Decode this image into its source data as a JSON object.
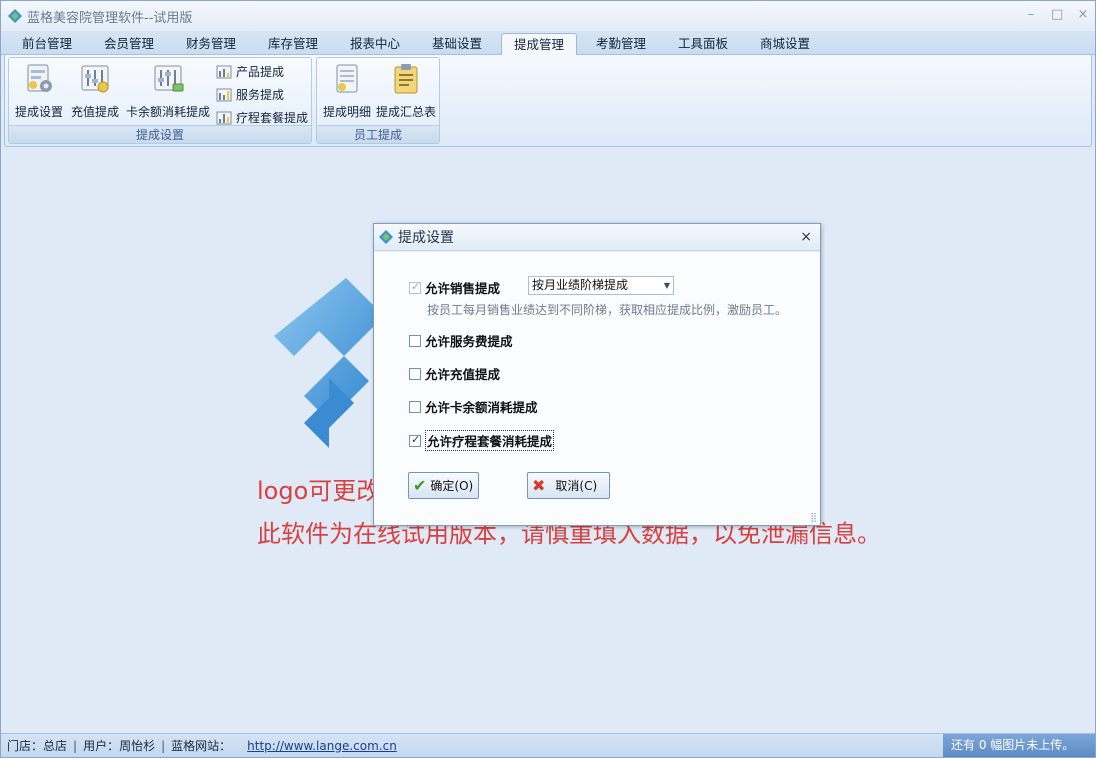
{
  "window": {
    "title": "蓝格美容院管理软件--试用版",
    "controls": {
      "minimize": "–",
      "maximize": "□",
      "close": "×"
    }
  },
  "tabs": [
    {
      "label": "前台管理",
      "active": false
    },
    {
      "label": "会员管理",
      "active": false
    },
    {
      "label": "财务管理",
      "active": false
    },
    {
      "label": "库存管理",
      "active": false
    },
    {
      "label": "报表中心",
      "active": false
    },
    {
      "label": "基础设置",
      "active": false
    },
    {
      "label": "提成管理",
      "active": true
    },
    {
      "label": "考勤管理",
      "active": false
    },
    {
      "label": "工具面板",
      "active": false
    },
    {
      "label": "商城设置",
      "active": false
    }
  ],
  "ribbon": {
    "group1": {
      "caption": "提成设置",
      "big_buttons": [
        "提成设置",
        "充值提成",
        "卡余额消耗提成"
      ],
      "small_buttons": [
        "产品提成",
        "服务提成",
        "疗程套餐提成"
      ]
    },
    "group2": {
      "caption": "员工提成",
      "big_buttons": [
        "提成明细",
        "提成汇总表"
      ]
    }
  },
  "main": {
    "watermark_line1": "logo可更改，请联系客服人员进行更换。",
    "watermark_line2": "此软件为在线试用版本，请慎重填入数据，以免泄漏信息。"
  },
  "dialog": {
    "title": "提成设置",
    "close": "×",
    "options": [
      {
        "label": "允许销售提成",
        "checked": true,
        "disabled": true
      },
      {
        "label": "允许服务费提成",
        "checked": false
      },
      {
        "label": "允许充值提成",
        "checked": false
      },
      {
        "label": "允许卡余额消耗提成",
        "checked": false
      },
      {
        "label": "允许疗程套餐消耗提成",
        "checked": true,
        "focused": true
      }
    ],
    "sales_mode": "按月业绩阶梯提成",
    "hint": "按员工每月销售业绩达到不同阶梯，获取相应提成比例，激励员工。",
    "ok_button": "确定(O)",
    "cancel_button": "取消(C)"
  },
  "statusbar": {
    "store": "门店：总店",
    "user": "用户：周怡杉",
    "site_label": "蓝格网站：",
    "site_url": "http://www.lange.com.cn",
    "upload_status": "还有 0 幅图片未上传。"
  },
  "colors": {
    "accent_blue": "#5e8bc7",
    "watermark_red": "#d94040",
    "background": "#dfeaf6"
  }
}
